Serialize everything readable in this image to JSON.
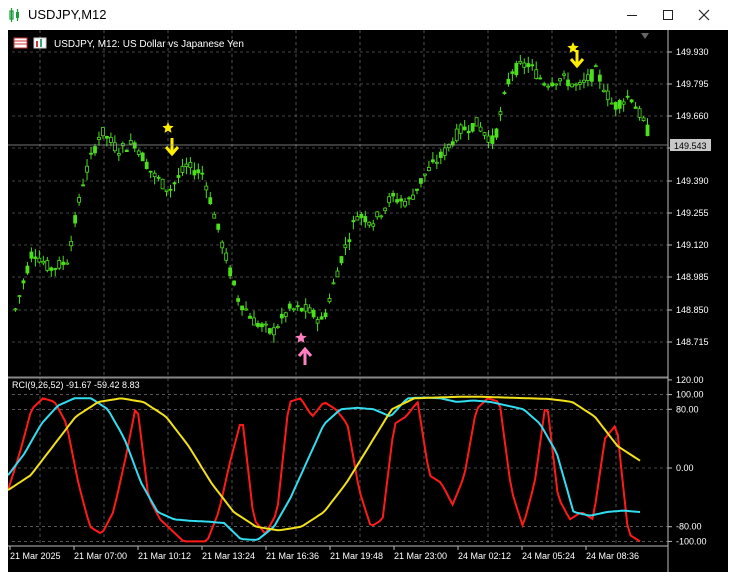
{
  "window": {
    "title": "USDJPY,M12",
    "min_icon": "minimize-icon",
    "max_icon": "maximize-icon",
    "close_icon": "close-icon"
  },
  "chart": {
    "header": "USDJPY, M12:  US Dollar vs Japanese Yen",
    "price_ticks": [
      "149.930",
      "149.795",
      "149.660",
      "149.525",
      "149.390",
      "149.255",
      "149.120",
      "148.985",
      "148.850",
      "148.715"
    ],
    "current_price": "149.543",
    "time_labels": [
      "21 Mar 2025",
      "21 Mar 07:00",
      "21 Mar 10:12",
      "21 Mar 13:24",
      "21 Mar 16:36",
      "21 Mar 19:48",
      "21 Mar 23:00",
      "24 Mar 02:12",
      "24 Mar 05:24",
      "24 Mar 08:36"
    ],
    "indicator_label": "RCI(9,26,52) -91.67 -59.42 8.83",
    "rci_ticks": [
      "120.00",
      "100.00",
      "80.00",
      "0.00",
      "-80.00",
      "-100.00"
    ],
    "colors": {
      "background": "#000000",
      "grid": "#888888",
      "candles": "#4cdf1c",
      "rci_fast": "#ff1a1a",
      "rci_mid": "#33ddf0",
      "rci_slow": "#f2e01a",
      "sell_marker": "#ffee00",
      "buy_marker": "#ff7fc0"
    }
  }
}
